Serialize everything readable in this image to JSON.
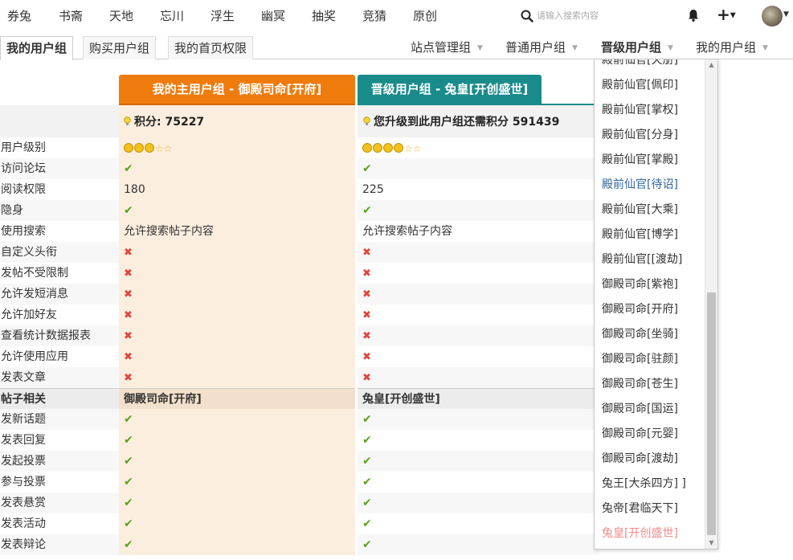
{
  "nav": {
    "items": [
      "券兔",
      "书斋",
      "天地",
      "忘川",
      "浮生",
      "幽冥",
      "抽奖",
      "竞猜",
      "原创"
    ],
    "search_placeholder": "请输入搜索内容",
    "plus_label": "+"
  },
  "tabs": {
    "left": [
      "我的用户组",
      "购买用户组",
      "我的首页权限"
    ],
    "right": [
      "站点管理组",
      "普通用户组",
      "晋级用户组",
      "我的用户组"
    ]
  },
  "columns": {
    "main": "我的主用户组 - 御殿司命[开府]",
    "upgrade": "晋级用户组 - 兔皇[开创盛世]"
  },
  "points": {
    "current": "积分: 75227",
    "required": "您升级到此用户组还需积分 591439"
  },
  "rows": [
    {
      "label": "用户级别",
      "v1": "",
      "v2": ""
    },
    {
      "label": "访问论坛",
      "v1": "✔",
      "v2": "✔"
    },
    {
      "label": "阅读权限",
      "v1": "180",
      "v2": "225"
    },
    {
      "label": "隐身",
      "v1": "✔",
      "v2": "✔"
    },
    {
      "label": "使用搜索",
      "v1": "允许搜索帖子内容",
      "v2": "允许搜索帖子内容"
    },
    {
      "label": "自定义头衔",
      "v1": "✖",
      "v2": "✖"
    },
    {
      "label": "发帖不受限制",
      "v1": "✖",
      "v2": "✖"
    },
    {
      "label": "允许发短消息",
      "v1": "✖",
      "v2": "✖"
    },
    {
      "label": "允许加好友",
      "v1": "✖",
      "v2": "✖"
    },
    {
      "label": "查看统计数据报表",
      "v1": "✖",
      "v2": "✖"
    },
    {
      "label": "允许使用应用",
      "v1": "✖",
      "v2": "✖"
    },
    {
      "label": "发表文章",
      "v1": "✖",
      "v2": "✖"
    },
    {
      "label": "帖子相关",
      "v1": "御殿司命[开府]",
      "v2": "兔皇[开创盛世]"
    },
    {
      "label": "发新话题",
      "v1": "✔",
      "v2": "✔"
    },
    {
      "label": "发表回复",
      "v1": "✔",
      "v2": "✔"
    },
    {
      "label": "发起投票",
      "v1": "✔",
      "v2": "✔"
    },
    {
      "label": "参与投票",
      "v1": "✔",
      "v2": "✔"
    },
    {
      "label": "发表悬赏",
      "v1": "✔",
      "v2": "✔"
    },
    {
      "label": "发表活动",
      "v1": "✔",
      "v2": "✔"
    },
    {
      "label": "发表辩论",
      "v1": "✔",
      "v2": "✔"
    }
  ],
  "dropdown": {
    "items": [
      "殿前仙官[天册]",
      "殿前仙官[佩印]",
      "殿前仙官[掌权]",
      "殿前仙官[分身]",
      "殿前仙官[掌殿]",
      "殿前仙官[待诏]",
      "殿前仙官[大乘]",
      "殿前仙官[博学]",
      "殿前仙官[[渡劫]",
      "御殿司命[紫袍]",
      "御殿司命[开府]",
      "御殿司命[坐骑]",
      "御殿司命[驻颜]",
      "御殿司命[苍生]",
      "御殿司命[国运]",
      "御殿司命[元婴]",
      "御殿司命[渡劫]",
      "兔王[大杀四方] ]",
      "兔帝[君临天下]",
      "兔皇[开创盛世]"
    ],
    "selected_index": 5,
    "current_index": 19
  },
  "colors": {
    "orange": "#f07b0d",
    "teal": "#1a8b8b",
    "check": "#5aa31b",
    "cross": "#e0463a"
  }
}
